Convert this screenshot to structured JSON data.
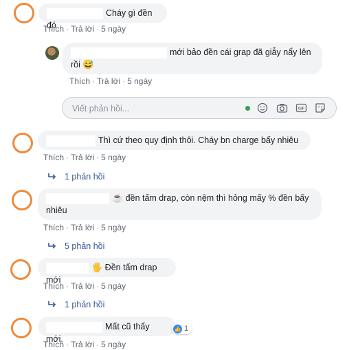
{
  "comments": [
    {
      "text": "Cháy gì đền đó",
      "actions": {
        "like": "Thích",
        "reply": "Trả lời",
        "time": "5 ngày"
      }
    },
    {
      "text": "mới bảo đền cái grap đã giẫy nẩy lên",
      "text2": "rồi",
      "emoji": "😅",
      "actions": {
        "like": "Thích",
        "reply": "Trả lời",
        "time": "5 ngày"
      }
    },
    {
      "text": "Thì cứ theo quy định thôi. Cháy bn charge bấy nhiêu",
      "actions": {
        "like": "Thích",
        "reply": "Trả lời",
        "time": "5 ngày"
      },
      "replies": "1 phản hồi"
    },
    {
      "emoji": "☕",
      "text": "đền tấm drap, còn nệm thì hỏng mấy % đền bấy",
      "text2": "nhiêu",
      "actions": {
        "like": "Thích",
        "reply": "Trả lời",
        "time": "5 ngày"
      },
      "replies": "5 phản hồi"
    },
    {
      "emoji": "🖐",
      "text": "Đền tấm drap mới",
      "actions": {
        "like": "Thích",
        "reply": "Trả lời",
        "time": "5 ngày"
      },
      "replies": "1 phản hồi"
    },
    {
      "text": "Mất cũ thấy mới.",
      "like_count": "1",
      "actions": {
        "like": "Thích",
        "reply": "Trả lời",
        "time": "5 ngày"
      }
    }
  ],
  "reply_box": {
    "placeholder": "Viết phản hồi...",
    "icons": [
      "online-indicator",
      "emoji-icon",
      "camera-icon",
      "gif-icon",
      "sticker-icon"
    ]
  },
  "colors": {
    "avatar_ring": "#ef8a3a",
    "bubble": "#f2f3f5",
    "link": "#385898",
    "like_blue": "#2d88ff",
    "online": "#31a24c"
  }
}
